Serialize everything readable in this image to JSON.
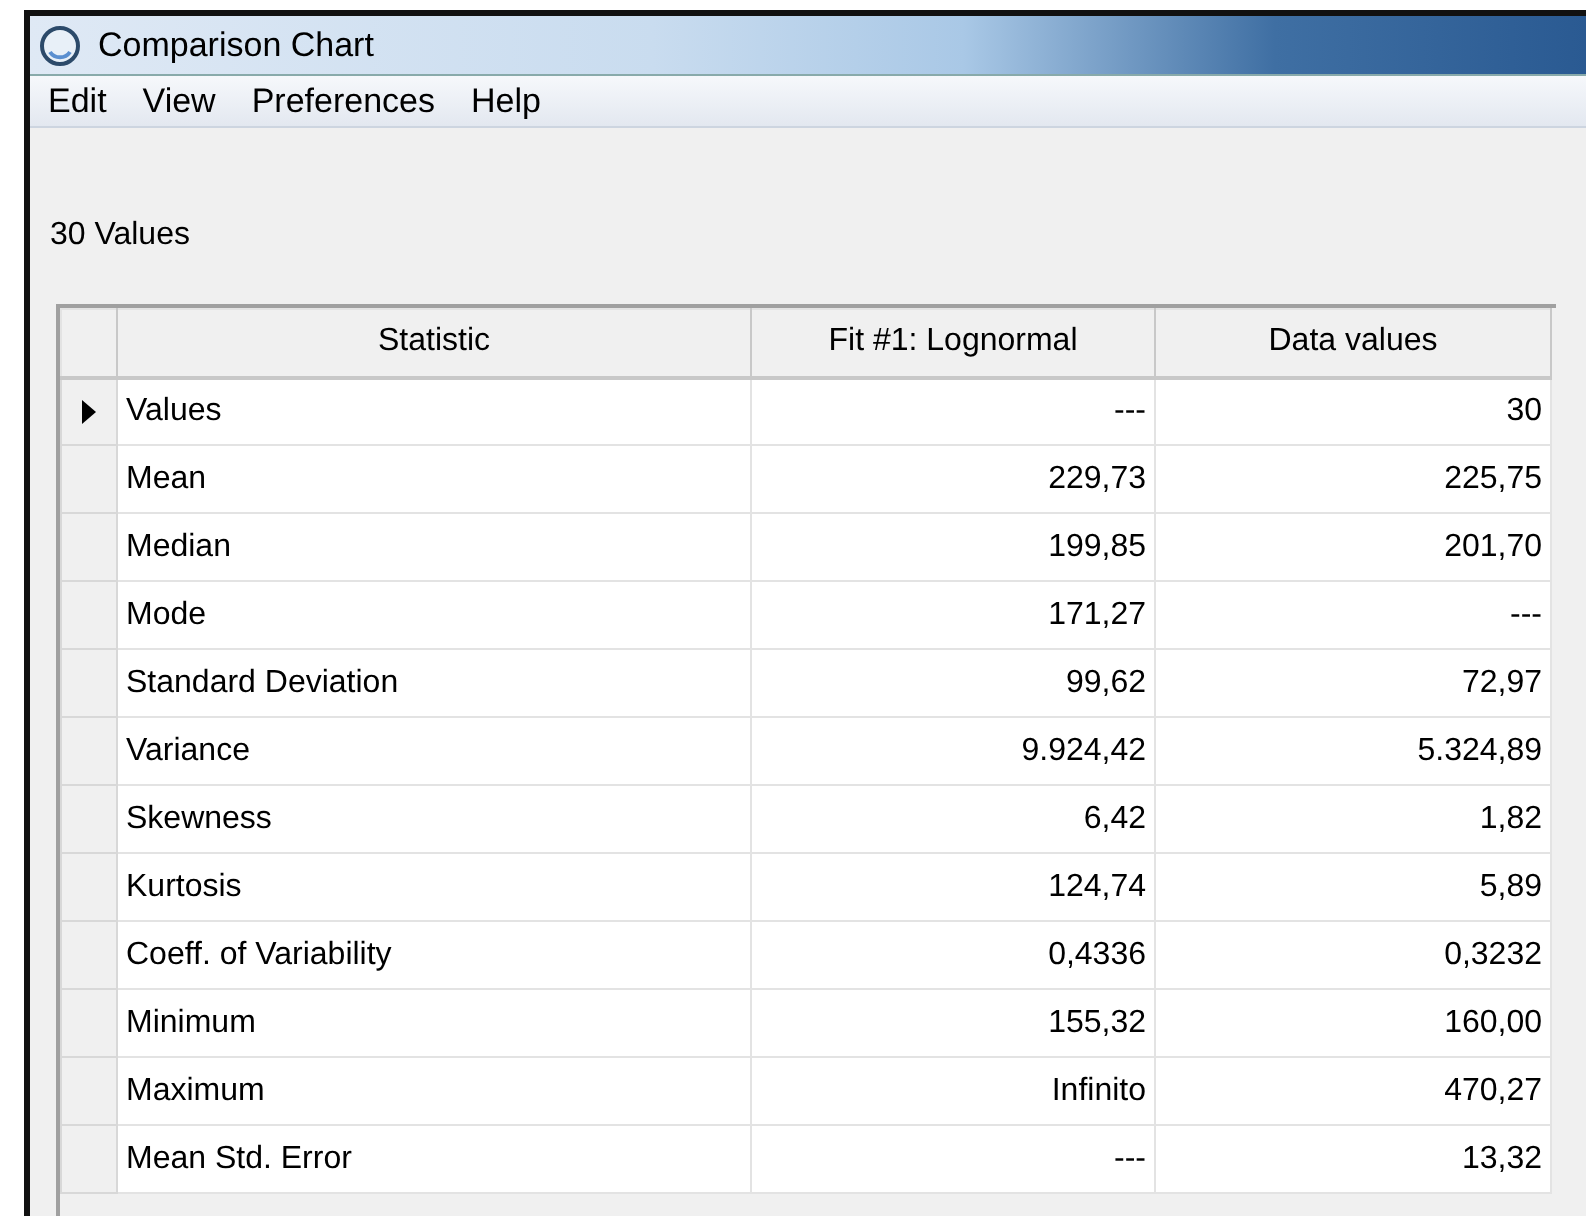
{
  "window": {
    "title": "Comparison Chart"
  },
  "menu": [
    "Edit",
    "View",
    "Preferences",
    "Help"
  ],
  "summary": "30 Values",
  "table": {
    "columns": [
      "Statistic",
      "Fit #1: Lognormal",
      "Data values"
    ],
    "rows": [
      {
        "current": true,
        "cells": [
          "Values",
          "---",
          "30"
        ]
      },
      {
        "current": false,
        "cells": [
          "Mean",
          "229,73",
          "225,75"
        ]
      },
      {
        "current": false,
        "cells": [
          "Median",
          "199,85",
          "201,70"
        ]
      },
      {
        "current": false,
        "cells": [
          "Mode",
          "171,27",
          "---"
        ]
      },
      {
        "current": false,
        "cells": [
          "Standard Deviation",
          "99,62",
          "72,97"
        ]
      },
      {
        "current": false,
        "cells": [
          "Variance",
          "9.924,42",
          "5.324,89"
        ]
      },
      {
        "current": false,
        "cells": [
          "Skewness",
          "6,42",
          "1,82"
        ]
      },
      {
        "current": false,
        "cells": [
          "Kurtosis",
          "124,74",
          "5,89"
        ]
      },
      {
        "current": false,
        "cells": [
          "Coeff. of Variability",
          "0,4336",
          "0,3232"
        ]
      },
      {
        "current": false,
        "cells": [
          "Minimum",
          "155,32",
          "160,00"
        ]
      },
      {
        "current": false,
        "cells": [
          "Maximum",
          "Infinito",
          "470,27"
        ]
      },
      {
        "current": false,
        "cells": [
          "Mean Std. Error",
          "---",
          "13,32"
        ]
      }
    ]
  }
}
